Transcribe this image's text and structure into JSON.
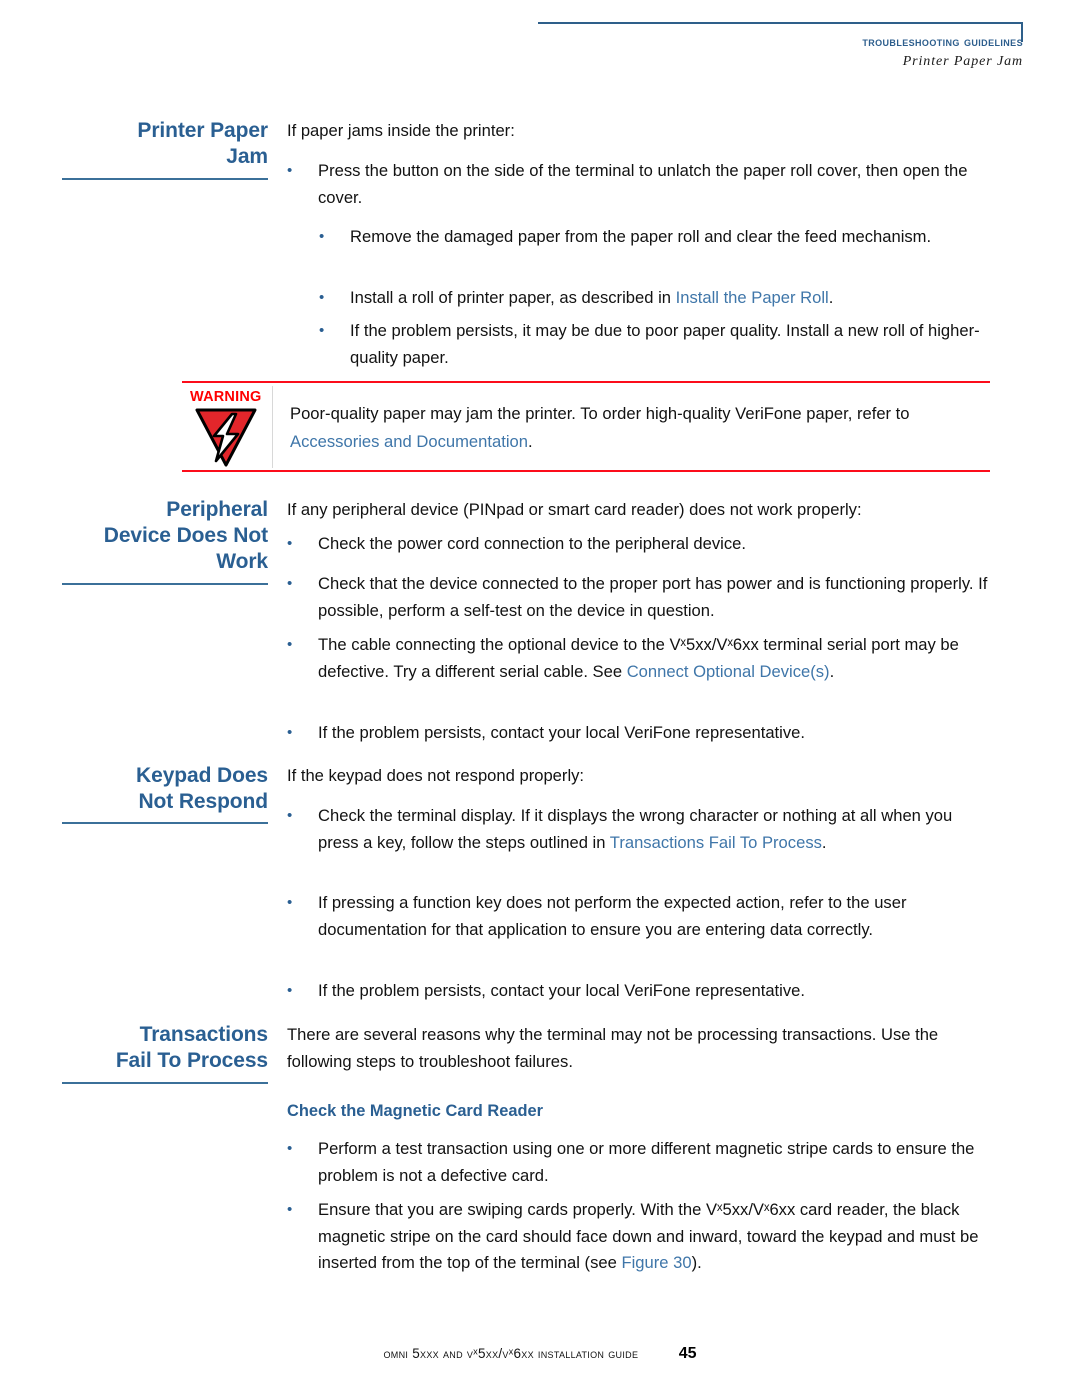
{
  "header": {
    "title": "Troubleshooting Guidelines",
    "subtitle": "Printer Paper Jam",
    "rule_color": "#2e5f8a"
  },
  "colors": {
    "heading_blue": "#2a5f92",
    "link_blue": "#3f76a9",
    "warning_red": "#ff0000",
    "body_black": "#121212"
  },
  "sections": [
    {
      "heading": "Printer Paper\nJam",
      "intro": "If paper jams inside the printer:",
      "bullets": [
        {
          "level": 1,
          "marker": "•",
          "text": "Press the button on the side of the terminal to unlatch the paper roll cover, then open the cover."
        },
        {
          "level": 2,
          "marker": "•",
          "text": "Remove the damaged paper from the paper roll and clear the feed mechanism."
        },
        {
          "level": 2,
          "marker": "•",
          "text_before": "Install a roll of printer paper, as described in ",
          "link": "Install the Paper Roll",
          "text_after": "."
        },
        {
          "level": 2,
          "marker": "•",
          "text": "If the problem persists, it may be due to poor paper quality. Install a new roll of higher-quality paper."
        }
      ]
    },
    {
      "heading": "Peripheral\nDevice Does Not\nWork",
      "intro": "If any peripheral device (PINpad or smart card reader) does not work properly:",
      "bullets": [
        {
          "level": 1,
          "marker": "•",
          "text": "Check the power cord connection to the peripheral device."
        },
        {
          "level": 1,
          "marker": "•",
          "text": "Check that the device connected to the proper port has power and is functioning properly. If possible, perform a self-test on the device in question."
        },
        {
          "level": 1,
          "marker": "•",
          "text_before": "The cable connecting the optional device to the Vˣ5xx/Vˣ6xx terminal serial port may be defective. Try a different serial cable. See ",
          "link": "Connect Optional Device(s)",
          "text_after": "."
        },
        {
          "level": 1,
          "marker": "•",
          "text": "If the problem persists, contact your local VeriFone representative."
        }
      ]
    },
    {
      "heading": "Keypad Does\nNot Respond",
      "intro": "If the keypad does not respond properly:",
      "bullets": [
        {
          "level": 1,
          "marker": "•",
          "text_before": "Check the terminal display. If it displays the wrong character or nothing at all when you press a key, follow the steps outlined in ",
          "link": "Transactions Fail To Process",
          "text_after": "."
        },
        {
          "level": 1,
          "marker": "•",
          "text": "If pressing a function key does not perform the expected action, refer to the user documentation for that application to ensure you are entering data correctly."
        },
        {
          "level": 1,
          "marker": "•",
          "text": "If the problem persists, contact your local VeriFone representative."
        }
      ]
    },
    {
      "heading": "Transactions\nFail To Process",
      "intro": "There are several reasons why the terminal may not be processing transactions. Use the following steps to troubleshoot failures.",
      "subheading": "Check the Magnetic Card Reader",
      "bullets": [
        {
          "level": 1,
          "marker": "•",
          "text": "Perform a test transaction using one or more different magnetic stripe cards to ensure the problem is not a defective card."
        },
        {
          "level": 1,
          "marker": "•",
          "text_before": "Ensure that you are swiping cards properly. With the Vˣ5xx/Vˣ6xx card reader, the black magnetic stripe on the card should face down and inward, toward the keypad and must be inserted from the top of the terminal (see ",
          "link": "Figure 30",
          "text_after": ")."
        }
      ]
    }
  ],
  "warning": {
    "label": "WARNING",
    "icon": "warning-triangle-lightning-icon",
    "text_before": "Poor-quality paper may jam the printer. To order high-quality VeriFone paper, refer to ",
    "link": "Accessories and Documentation",
    "text_after": "."
  },
  "footer": {
    "guide": "Omni 5xxx and Vˣ5xx/Vˣ6xx Installation Guide",
    "page_number": "45"
  }
}
